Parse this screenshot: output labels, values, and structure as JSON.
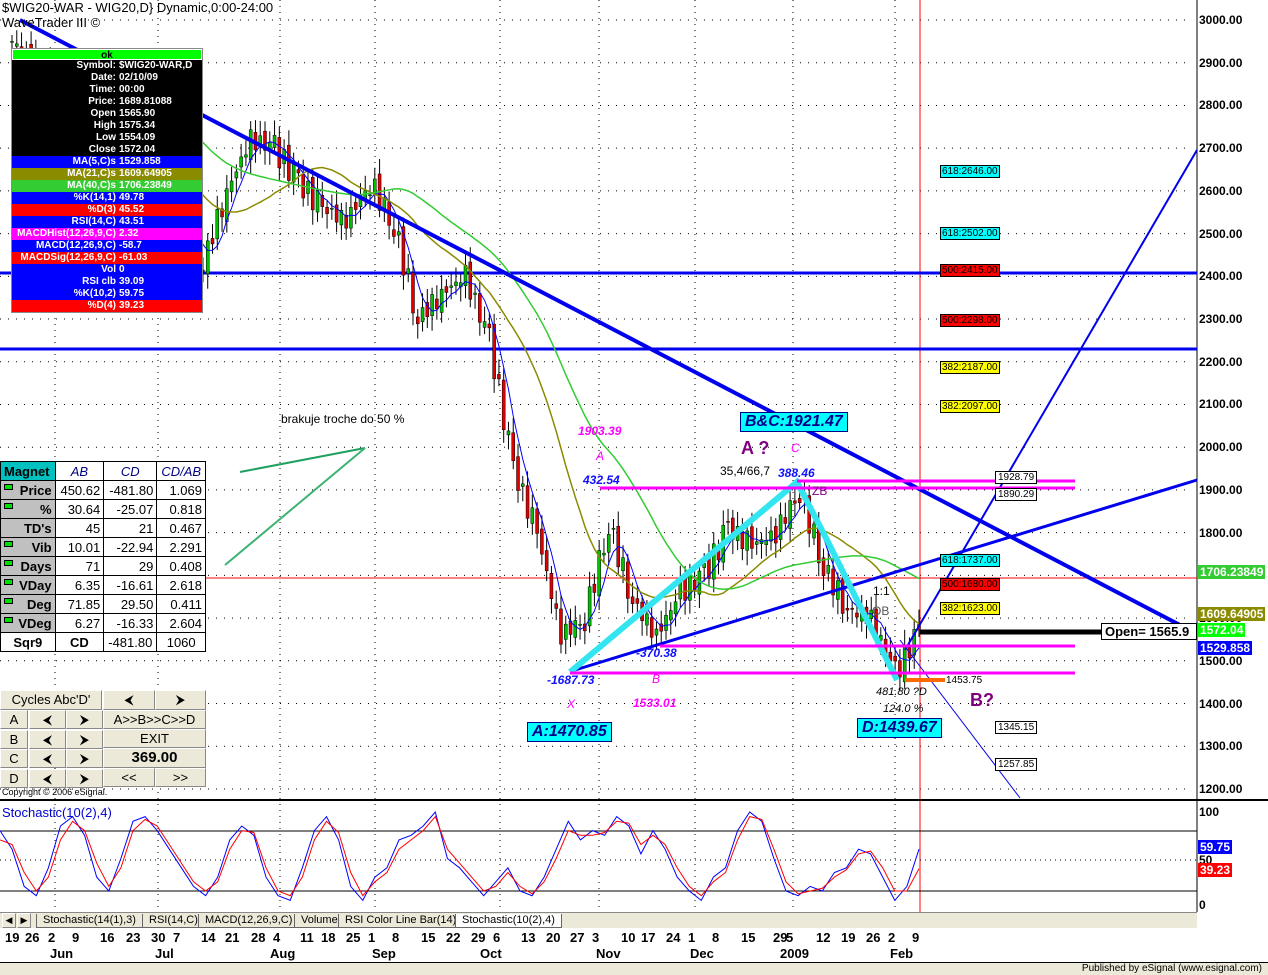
{
  "window": {
    "title": "$WIG20-WAR - WIG20,D} Dynamic,0:00-24:00",
    "subtitle": "WaveTrader III ©"
  },
  "info_box": {
    "status": "ok",
    "rows": [
      {
        "k": "Symbol:",
        "v": "$WIG20-WAR,D",
        "bg": "#000000",
        "fg": "#ffffff"
      },
      {
        "k": "Date:",
        "v": "02/10/09",
        "bg": "#000000",
        "fg": "#ffffff"
      },
      {
        "k": "Time:",
        "v": "00:00",
        "bg": "#000000",
        "fg": "#ffffff"
      },
      {
        "k": "Price:",
        "v": "1689.81088",
        "bg": "#000000",
        "fg": "#ffffff"
      },
      {
        "k": "Open",
        "v": "1565.90",
        "bg": "#000000",
        "fg": "#ffffff"
      },
      {
        "k": "High",
        "v": "1575.34",
        "bg": "#000000",
        "fg": "#ffffff"
      },
      {
        "k": "Low",
        "v": "1554.09",
        "bg": "#000000",
        "fg": "#ffffff"
      },
      {
        "k": "Close",
        "v": "1572.04",
        "bg": "#000000",
        "fg": "#ffffff"
      },
      {
        "k": "MA(5,C)s",
        "v": "1529.858",
        "bg": "#0000ff",
        "fg": "#ffffff"
      },
      {
        "k": "MA(21,C)s",
        "v": "1609.64905",
        "bg": "#8b8b00",
        "fg": "#ffffff"
      },
      {
        "k": "MA(40,C)s",
        "v": "1706.23849",
        "bg": "#33cc33",
        "fg": "#ffffff"
      },
      {
        "k": "%K(14,1)",
        "v": "49.78",
        "bg": "#0000ff",
        "fg": "#ffffff"
      },
      {
        "k": "%D(3)",
        "v": "45.52",
        "bg": "#ff0000",
        "fg": "#ffffff"
      },
      {
        "k": "RSI(14,C)",
        "v": "43.51",
        "bg": "#0000ff",
        "fg": "#ffffff"
      },
      {
        "k": "MACDHist(12,26,9,C)",
        "v": "2.32",
        "bg": "#ff00ff",
        "fg": "#ffffff"
      },
      {
        "k": "MACD(12,26,9,C)",
        "v": "-58.7",
        "bg": "#0000ff",
        "fg": "#ffffff"
      },
      {
        "k": "MACDSig(12,26,9,C)",
        "v": "-61.03",
        "bg": "#ff0000",
        "fg": "#ffffff"
      },
      {
        "k": "Vol",
        "v": "0",
        "bg": "#0000ff",
        "fg": "#ffffff"
      },
      {
        "k": "RSI clb",
        "v": "39.09",
        "bg": "#0000ff",
        "fg": "#ffffff"
      },
      {
        "k": "%K(10,2)",
        "v": "59.75",
        "bg": "#0000ff",
        "fg": "#ffffff"
      },
      {
        "k": "%D(4)",
        "v": "39.23",
        "bg": "#ff0000",
        "fg": "#ffffff"
      }
    ]
  },
  "magnet": {
    "headers": [
      "Magnet",
      "AB",
      "CD",
      "CD/AB"
    ],
    "rows": [
      {
        "label": "Price",
        "flag": true,
        "ab": "450.62",
        "cd": "-481.80",
        "ratio": "1.069"
      },
      {
        "label": "%",
        "flag": true,
        "ab": "30.64",
        "cd": "-25.07",
        "ratio": "0.818"
      },
      {
        "label": "TD's",
        "flag": false,
        "ab": "45",
        "cd": "21",
        "ratio": "0.467"
      },
      {
        "label": "Vib",
        "flag": true,
        "ab": "10.01",
        "cd": "-22.94",
        "ratio": "2.291"
      },
      {
        "label": "Days",
        "flag": true,
        "ab": "71",
        "cd": "29",
        "ratio": "0.408"
      },
      {
        "label": "VDay",
        "flag": true,
        "ab": "6.35",
        "cd": "-16.61",
        "ratio": "2.618"
      },
      {
        "label": "Deg",
        "flag": true,
        "ab": "71.85",
        "cd": "29.50",
        "ratio": "0.411"
      },
      {
        "label": "VDeg",
        "flag": true,
        "ab": "6.27",
        "cd": "-16.33",
        "ratio": "2.604"
      }
    ],
    "sqr9": {
      "label": "Sqr9",
      "ab": "CD",
      "cd": "-481.80",
      "ratio": "1060"
    }
  },
  "cycles": {
    "title": "Cycles Abc'D'",
    "rows": [
      "A",
      "B",
      "C",
      "D"
    ],
    "prev": "⮜",
    "next": "⮞",
    "sequence": "A>>B>>C>>D",
    "exit": "EXIT",
    "value": "369.00",
    "rewind": "<<",
    "forward": ">>"
  },
  "copyright": "Copyright © 2006 eSignal.",
  "annotations": {
    "note": "brakuje troche do 50 %",
    "bc": "B&C:1921.47",
    "a_box": "A:1470.85",
    "d_box": "D:1439.67",
    "a_q": "A ?",
    "b_q": "B?",
    "c": "C",
    "a": "A",
    "b": "B",
    "x": "X",
    "p1903": "1903.39",
    "p43254": "432.54",
    "p1533": "1533.01",
    "p37038": "-370.38",
    "p168773": "-1687.73",
    "p38846": "388.46",
    "ratio_text": "35,4/66,7",
    "d_text": "481.80 ?D",
    "pct": "124.0 %",
    "t11": "1:1",
    "ob": "OB",
    "zb": "ZB"
  },
  "fib_levels": [
    {
      "label": "618:2646.00",
      "color": "#00ffff",
      "price": 2646
    },
    {
      "label": "618:2502.00",
      "color": "#00ffff",
      "price": 2502
    },
    {
      "label": "500:2415.00",
      "color": "#ff0000",
      "price": 2415
    },
    {
      "label": "500:2298.00",
      "color": "#ff0000",
      "price": 2298
    },
    {
      "label": "382:2187.00",
      "color": "#ffff00",
      "price": 2187
    },
    {
      "label": "382:2097.00",
      "color": "#ffff00",
      "price": 2097
    },
    {
      "label": "618:1737.00",
      "color": "#00ffff",
      "price": 1737
    },
    {
      "label": "500:1680.00",
      "color": "#ff0000",
      "price": 1680
    },
    {
      "label": "382:1623.00",
      "color": "#ffff00",
      "price": 1623
    }
  ],
  "price_boxes": [
    "1928.79",
    "1890.29",
    "1453.75",
    "1345.15",
    "1257.85"
  ],
  "open_label": "Open= 1565.9",
  "price_axis": [
    "3000.00",
    "2900.00",
    "2800.00",
    "2700.00",
    "2600.00",
    "2500.00",
    "2400.00",
    "2300.00",
    "2200.00",
    "2100.00",
    "2000.00",
    "1900.00",
    "1800.00",
    "1700.00",
    "1600.00",
    "1500.00",
    "1400.00",
    "1300.00",
    "1200.00"
  ],
  "axis_tags": [
    {
      "v": "1706.23849",
      "bg": "#33cc33",
      "fg": "#ffffff"
    },
    {
      "v": "1609.64905",
      "bg": "#8b8b00",
      "fg": "#ffffff"
    },
    {
      "v": "1572.04",
      "bg": "#00ff00",
      "fg": "#ffffff"
    },
    {
      "v": "1529.858",
      "bg": "#0000ff",
      "fg": "#ffffff"
    }
  ],
  "stochastic": {
    "title": "Stochastic(10(2),4)",
    "axis": [
      "100",
      "50",
      "0"
    ],
    "k_tag": "59.75",
    "d_tag": "39.23",
    "k": [
      80,
      60,
      20,
      10,
      40,
      85,
      95,
      75,
      30,
      15,
      50,
      90,
      95,
      80,
      60,
      40,
      20,
      10,
      30,
      70,
      85,
      75,
      30,
      10,
      5,
      40,
      80,
      95,
      70,
      20,
      5,
      30,
      40,
      70,
      75,
      85,
      100,
      50,
      40,
      25,
      10,
      25,
      40,
      15,
      10,
      30,
      60,
      90,
      70,
      80,
      75,
      95,
      85,
      55,
      80,
      60,
      30,
      15,
      5,
      30,
      40,
      80,
      110,
      90,
      50,
      15,
      10,
      20,
      15,
      35,
      40,
      60,
      55,
      30,
      5,
      20,
      60
    ],
    "d": [
      70,
      65,
      35,
      15,
      30,
      70,
      90,
      80,
      45,
      20,
      40,
      80,
      92,
      85,
      65,
      45,
      25,
      15,
      25,
      60,
      80,
      78,
      40,
      15,
      10,
      30,
      70,
      90,
      78,
      35,
      10,
      25,
      35,
      60,
      70,
      80,
      95,
      60,
      45,
      30,
      15,
      20,
      35,
      20,
      12,
      25,
      50,
      80,
      75,
      75,
      78,
      90,
      88,
      65,
      75,
      65,
      40,
      20,
      10,
      25,
      35,
      70,
      95,
      92,
      60,
      25,
      12,
      15,
      18,
      30,
      38,
      55,
      58,
      40,
      15,
      15,
      39
    ]
  },
  "tabs": [
    "Stochastic(14(1),3)",
    "RSI(14,C)",
    "MACD(12,26,9,C)",
    "Volume",
    "RSI Color Line Bar(14)",
    "Stochastic(10(2),4)"
  ],
  "date_axis": {
    "days": [
      "19",
      "26",
      "2",
      "9",
      "16",
      "23",
      "30",
      "7",
      "14",
      "21",
      "28",
      "4",
      "11",
      "18",
      "25",
      "1",
      "8",
      "15",
      "22",
      "29",
      "6",
      "13",
      "20",
      "27",
      "3",
      "10",
      "17",
      "24",
      "1",
      "8",
      "15",
      "29",
      "5",
      "12",
      "19",
      "26",
      "2",
      "9"
    ],
    "months": [
      "Jun",
      "Jul",
      "Aug",
      "Sep",
      "Oct",
      "Nov",
      "Dec",
      "2009",
      "Feb"
    ]
  },
  "status_bar": "Published by eSignal (www.esignal.com)",
  "chart_data": {
    "type": "candlestick",
    "title": "$WIG20-WAR - WIG20,D",
    "ylim": [
      1200,
      3000
    ],
    "weekly_close": [
      2950,
      2900,
      2850,
      2800,
      2720,
      2650,
      2600,
      2550,
      2430,
      2600,
      2720,
      2700,
      2620,
      2560,
      2530,
      2620,
      2520,
      2300,
      2360,
      2400,
      2250,
      1950,
      1800,
      1560,
      1600,
      1820,
      1640,
      1560,
      1660,
      1700,
      1810,
      1770,
      1800,
      1900,
      1720,
      1620,
      1600,
      1470,
      1572
    ]
  }
}
